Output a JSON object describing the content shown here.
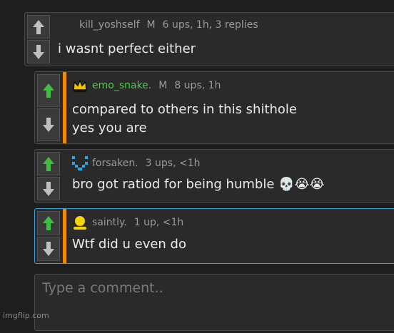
{
  "comments": [
    {
      "username": "kill_yoshself",
      "badge": "M",
      "stats": "6 ups, 1h, 3 replies",
      "lines": [
        "i wasnt perfect either"
      ],
      "vote_state": "none"
    },
    {
      "username": "emo_snake.",
      "badge": "M",
      "stats": "8 ups, 1h",
      "lines": [
        "compared to others in this shithole",
        "yes you are"
      ],
      "vote_state": "up",
      "avatar_icon": "crown-icon"
    },
    {
      "username": "forsaken.",
      "stats": "3 ups, <1h",
      "lines": [
        "bro got ratiod for being humble 💀😭😭"
      ],
      "vote_state": "up",
      "avatar_icon": "pixel-avatar-icon"
    },
    {
      "username": "saintly.",
      "stats": "1 up, <1h",
      "lines": [
        "Wtf did u even do"
      ],
      "vote_state": "up",
      "avatar_icon": "yellow-user-icon"
    }
  ],
  "composer": {
    "placeholder": "Type a comment.."
  },
  "watermark": "imgflip.com",
  "colors": {
    "upvoted": "#3fbf3f",
    "neutral_arrow": "#bfbfbf",
    "op_stripe": "#f08a00",
    "focus_border": "#3a9fd8",
    "username_highlight": "#4ec94e"
  }
}
